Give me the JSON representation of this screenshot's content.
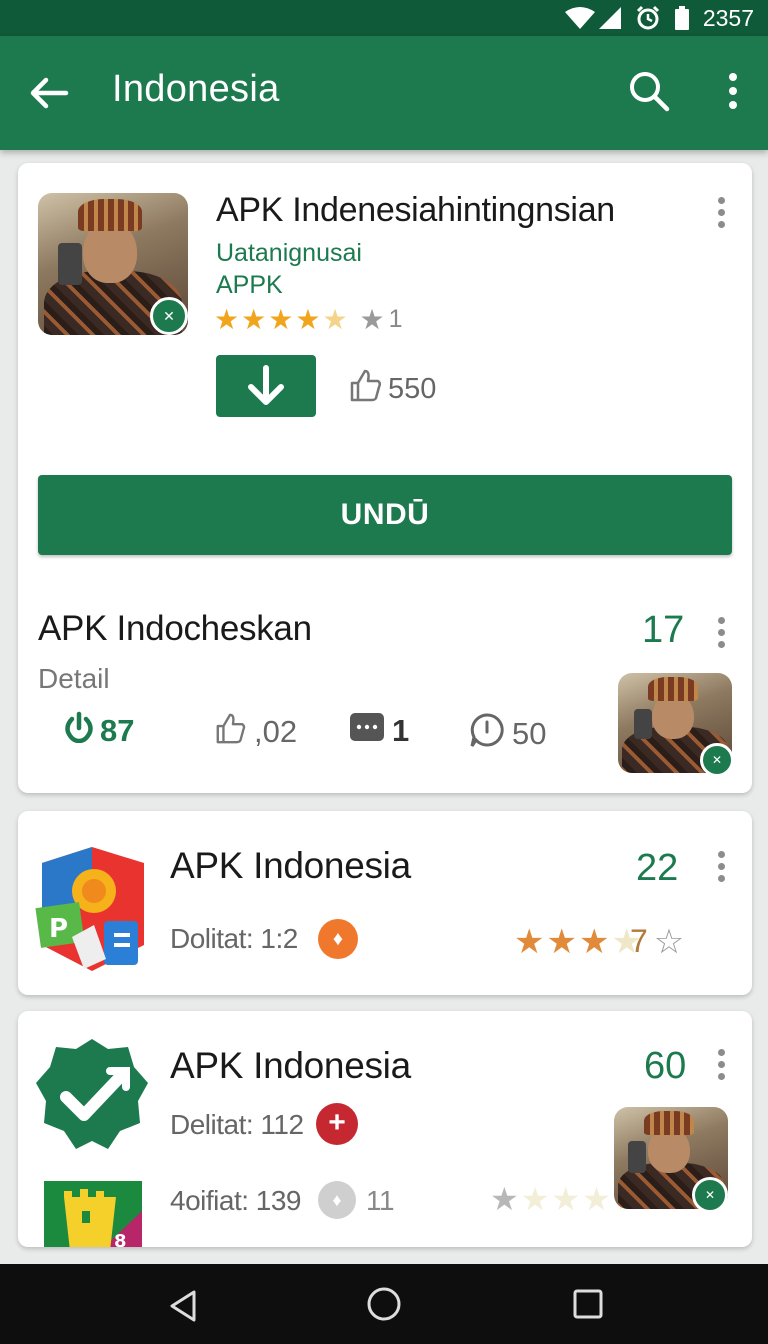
{
  "status_bar": {
    "time": "2357",
    "icons": [
      "wifi-icon",
      "signal-icon",
      "alarm-icon",
      "battery-icon"
    ]
  },
  "app_bar": {
    "title": "Indonesia",
    "icons": [
      "back-arrow-icon",
      "search-icon",
      "more-vert-icon"
    ]
  },
  "featured": {
    "title": "APK Indenesiahintingnsian",
    "subtitle_1": "Uatanignusai",
    "subtitle_2": "APPK",
    "rating_stars": 4.5,
    "rating_suffix": "1",
    "likes": "550",
    "primary_button": "UNDŪ",
    "section_title": "APK Indocheskan",
    "section_subtitle": "Detail",
    "section_count": "17",
    "stats": {
      "downloads": "87",
      "likes": ",02",
      "messages": "1",
      "comments": "50"
    }
  },
  "list": [
    {
      "title": "APK Indonesia",
      "meta": "Dolitat: 1:2",
      "count": "22",
      "rating_stars": 3.5,
      "rating_value": "7",
      "icon": "puzzle-app-icon"
    },
    {
      "title": "APK Indonesia",
      "meta": "Delitat: 112",
      "meta_2": "4oifiat: 139",
      "meta_2_badge": "11",
      "count": "60",
      "icon": "shield-check-app-icon",
      "icon_2": "castle-app-icon",
      "icon_2_badge": "8"
    }
  ],
  "colors": {
    "primary": "#1c7a4e",
    "status_bar": "#0f5a38",
    "star": "#f0a51d",
    "accent_orange": "#f0782d",
    "accent_red": "#c62832"
  }
}
